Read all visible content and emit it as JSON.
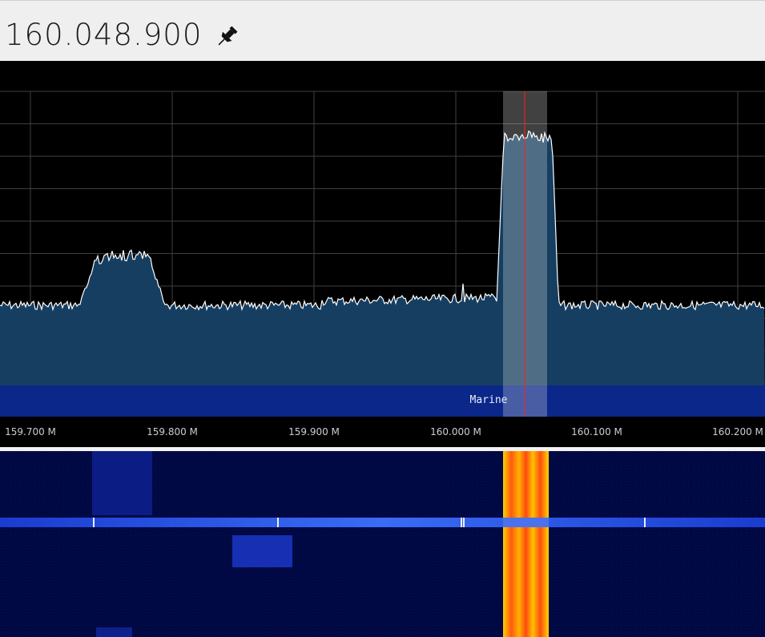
{
  "header": {
    "frequency": "160.048.900",
    "pin_icon": "pushpin-icon"
  },
  "spectrum": {
    "band_label": "Marine",
    "axis_labels": [
      "159.700 M",
      "159.800 M",
      "159.900 M",
      "160.000 M",
      "160.100 M",
      "160.200 M"
    ],
    "colors": {
      "background": "#000000",
      "fill": "#163e60",
      "trace": "#ffffff",
      "grid": "#3f3f3f",
      "band": "#0a2789",
      "tuning_line": "#ff2020"
    }
  },
  "waterfall": {
    "colors": {
      "background": "#00063b",
      "hot": "#ff4a10",
      "warm": "#ffd000",
      "line": "#2d65f0"
    }
  }
}
